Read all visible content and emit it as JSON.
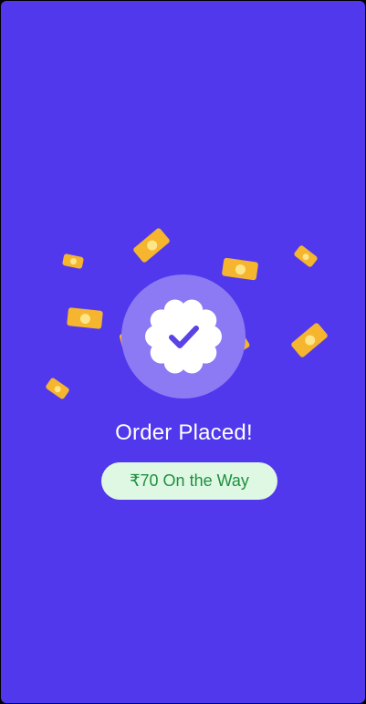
{
  "screen": {
    "background_color": "#5138ec",
    "halo_color": "#8c7af4",
    "badge_color": "#ffffff",
    "check_color": "#5a43e6",
    "note_color": "#f5b52e",
    "note_coin_color": "#fde68a"
  },
  "confirmation": {
    "title": "Order Placed!",
    "amount_text": "₹70 On the Way",
    "pill_background": "#def8e4",
    "pill_text_color": "#1f8f3e",
    "badge_icon": "check-badge-icon",
    "decoration_icon": "money-note-icon"
  }
}
